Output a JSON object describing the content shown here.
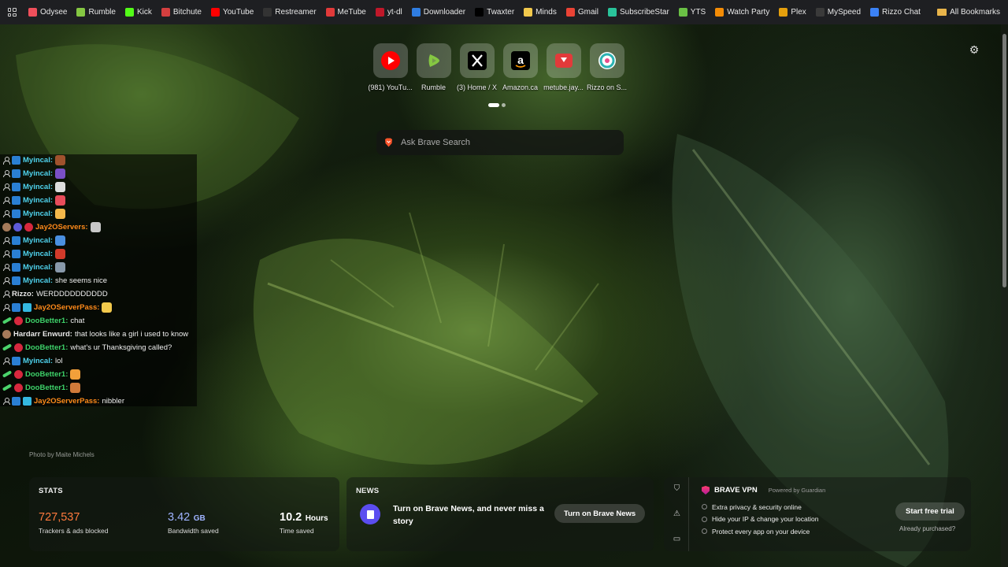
{
  "bookmarks": {
    "items": [
      {
        "label": "Odysee",
        "color": "#ef4f5b"
      },
      {
        "label": "Rumble",
        "color": "#85c742"
      },
      {
        "label": "Kick",
        "color": "#53fc18"
      },
      {
        "label": "Bitchute",
        "color": "#d43f3f"
      },
      {
        "label": "YouTube",
        "color": "#ff0000"
      },
      {
        "label": "Restreamer",
        "color": "#333333"
      },
      {
        "label": "MeTube",
        "color": "#e23a3a"
      },
      {
        "label": "yt-dl",
        "color": "#c0182a"
      },
      {
        "label": "Downloader",
        "color": "#2f7de1"
      },
      {
        "label": "Twaxter",
        "color": "#000000"
      },
      {
        "label": "Minds",
        "color": "#f2c94c"
      },
      {
        "label": "Gmail",
        "color": "#ea4335"
      },
      {
        "label": "SubscribeStar",
        "color": "#29c39a"
      },
      {
        "label": "YTS",
        "color": "#6ac045"
      },
      {
        "label": "Watch Party",
        "color": "#f48c06"
      },
      {
        "label": "Plex",
        "color": "#e5a00d"
      },
      {
        "label": "MySpeed",
        "color": "#3a3a3a"
      },
      {
        "label": "Rizzo Chat",
        "color": "#3b82f6"
      }
    ],
    "all_bookmarks": "All Bookmarks"
  },
  "top_sites": [
    {
      "label": "(981) YouTu...",
      "icon": "youtube-icon",
      "color": "#ff0000"
    },
    {
      "label": "Rumble",
      "icon": "rumble-icon",
      "color": "#85c742"
    },
    {
      "label": "(3) Home / X",
      "icon": "x-icon",
      "color": "#000000"
    },
    {
      "label": "Amazon.ca",
      "icon": "amazon-icon",
      "color": "#000000"
    },
    {
      "label": "metube.jay...",
      "icon": "metube-icon",
      "color": "#e23a3a"
    },
    {
      "label": "Rizzo on S...",
      "icon": "rizzo-icon",
      "color": "#2bb3b3"
    }
  ],
  "search": {
    "placeholder": "Ask Brave Search"
  },
  "chat": [
    {
      "user": "Myincal:",
      "cls": "u-myincal",
      "msg": "",
      "emote": "#a0522d"
    },
    {
      "user": "Myincal:",
      "cls": "u-myincal",
      "msg": "",
      "emote": "#7a4fc7"
    },
    {
      "user": "Myincal:",
      "cls": "u-myincal",
      "msg": "",
      "emote": "#dddddd"
    },
    {
      "user": "Myincal:",
      "cls": "u-myincal",
      "msg": "",
      "emote": "#e84c5a"
    },
    {
      "user": "Myincal:",
      "cls": "u-myincal",
      "msg": "",
      "emote": "#f5b84a"
    },
    {
      "user": "Jay2OServers:",
      "cls": "u-jay",
      "msg": "",
      "emote": "#c8c8c8"
    },
    {
      "user": "Myincal:",
      "cls": "u-myincal",
      "msg": "",
      "emote": "#4a8fe0"
    },
    {
      "user": "Myincal:",
      "cls": "u-myincal",
      "msg": "",
      "emote": "#d23a2a"
    },
    {
      "user": "Myincal:",
      "cls": "u-myincal",
      "msg": "",
      "emote": "#8899aa"
    },
    {
      "user": "Myincal:",
      "cls": "u-myincal",
      "msg": "she seems nice",
      "emote": ""
    },
    {
      "user": "Rizzo:",
      "cls": "u-rizzo",
      "msg": "WERDDDDDDDDDD",
      "emote": ""
    },
    {
      "user": "Jay2OServerPass:",
      "cls": "u-jay",
      "msg": "",
      "emote": "#f2c94c"
    },
    {
      "user": "DooBetter1:",
      "cls": "u-doob",
      "msg": "chat",
      "emote": ""
    },
    {
      "user": "Hardarr Enwurd:",
      "cls": "u-hard",
      "msg": "that looks like a girl i used to know",
      "emote": ""
    },
    {
      "user": "DooBetter1:",
      "cls": "u-doob",
      "msg": "what's ur Thanksgiving called?",
      "emote": ""
    },
    {
      "user": "Myincal:",
      "cls": "u-myincal",
      "msg": "lol",
      "emote": ""
    },
    {
      "user": "DooBetter1:",
      "cls": "u-doob",
      "msg": "",
      "emote": "#f2a03a"
    },
    {
      "user": "DooBetter1:",
      "cls": "u-doob",
      "msg": "",
      "emote": "#d07a3a"
    },
    {
      "user": "Jay2OServerPass:",
      "cls": "u-jay",
      "msg": "nibbler",
      "emote": ""
    }
  ],
  "credit": "Photo by Maite Michels",
  "stats": {
    "title": "STATS",
    "trackers": {
      "value": "727,537",
      "caption": "Trackers & ads blocked"
    },
    "bandwidth": {
      "value": "3.42",
      "unit": "GB",
      "caption": "Bandwidth saved"
    },
    "time": {
      "value": "10.2",
      "unit": "Hours",
      "caption": "Time saved"
    }
  },
  "news": {
    "title": "NEWS",
    "text": "Turn on Brave News, and never miss a story",
    "button": "Turn on Brave News"
  },
  "vpn": {
    "title": "BRAVE VPN",
    "powered": "Powered by Guardian",
    "features": [
      "Extra privacy & security online",
      "Hide your IP & change your location",
      "Protect every app on your device"
    ],
    "button": "Start free trial",
    "link": "Already purchased?"
  }
}
